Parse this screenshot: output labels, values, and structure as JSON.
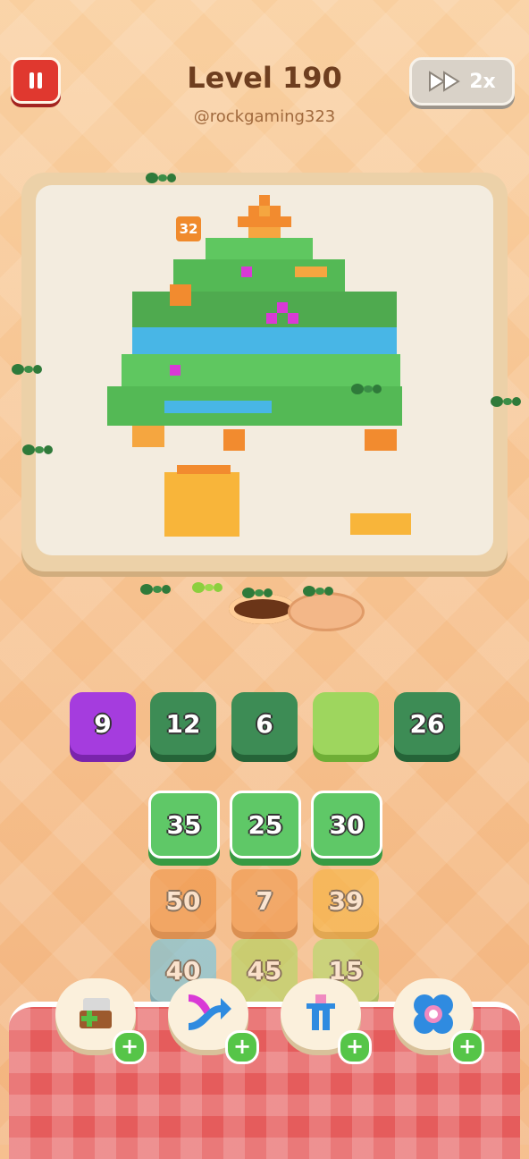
{
  "header": {
    "level_title": "Level 190",
    "username": "@rockgaming323",
    "speed_label": "2x"
  },
  "board": {
    "counter": "32"
  },
  "tiles": {
    "row1": [
      {
        "value": "9",
        "color": "#a53cde"
      },
      {
        "value": "12",
        "color": "#3d8c55"
      },
      {
        "value": "6",
        "color": "#3d8c55"
      },
      {
        "value": "",
        "color": "#9ed65e"
      },
      {
        "value": "26",
        "color": "#3d8c55"
      }
    ],
    "row2": [
      "35",
      "25",
      "30"
    ],
    "row3": [
      "50",
      "7",
      "39"
    ],
    "row4": [
      "40",
      "45",
      "15"
    ]
  },
  "powerups": [
    {
      "icon": "add-tray-icon"
    },
    {
      "icon": "shuffle-arrows-icon"
    },
    {
      "icon": "magnet-claw-icon"
    },
    {
      "icon": "flower-bomb-icon"
    }
  ]
}
